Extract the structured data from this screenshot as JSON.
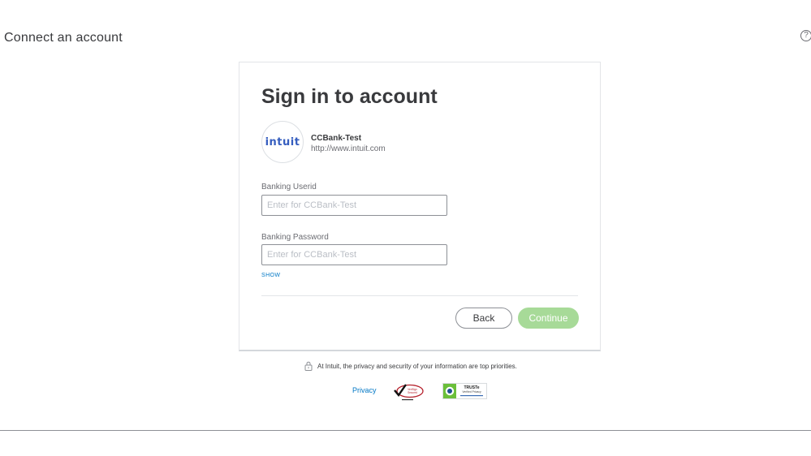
{
  "header": {
    "title": "Connect an account",
    "help_glyph": "?"
  },
  "signin": {
    "title": "Sign in to account",
    "bank": {
      "logo_text": "intuit",
      "name": "CCBank-Test",
      "url": "http://www.intuit.com",
      "logo_icon": "intuit-logo",
      "logo_color": "#365ebf"
    },
    "userid": {
      "label": "Banking Userid",
      "placeholder": "Enter for CCBank-Test",
      "value": ""
    },
    "password": {
      "label": "Banking Password",
      "placeholder": "Enter for CCBank-Test",
      "value": ""
    },
    "show_label": "SHOW",
    "back_label": "Back",
    "continue_label": "Continue"
  },
  "footer": {
    "privacy_text": "At Intuit, the privacy and security of your information are top priorities.",
    "privacy_link": "Privacy",
    "seal1": {
      "icon": "verisign-secured-seal",
      "line1": "VeriSign",
      "line2": "Secured"
    },
    "seal2": {
      "icon": "truste-verified-privacy-seal",
      "line1": "TRUSTe",
      "line2": "Verified Privacy"
    }
  },
  "colors": {
    "accent": "#0077c5",
    "continue_disabled": "#a7da98",
    "text": "#393a3d"
  }
}
